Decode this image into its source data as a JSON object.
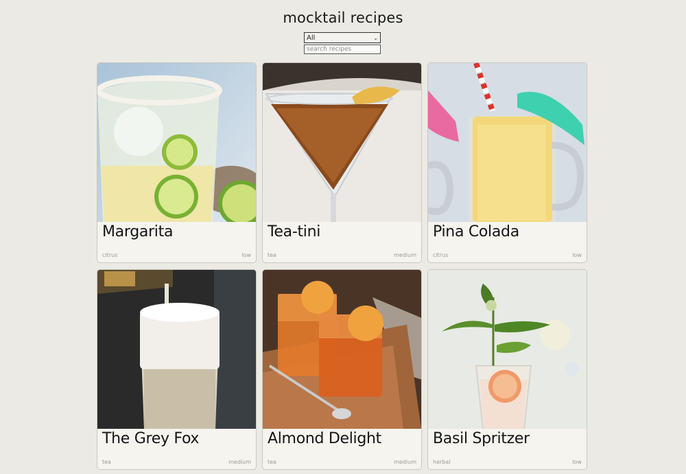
{
  "header": {
    "title": "mocktail recipes"
  },
  "filter": {
    "selected": "All"
  },
  "search": {
    "placeholder": "search recipes"
  },
  "recipes": [
    {
      "name": "Margarita",
      "category": "citrus",
      "strength": "low",
      "photo_icon": "margarita-glass-icon"
    },
    {
      "name": "Tea-tini",
      "category": "tea",
      "strength": "medium",
      "photo_icon": "martini-glass-icon"
    },
    {
      "name": "Pina Colada",
      "category": "citrus",
      "strength": "low",
      "photo_icon": "mug-with-umbrellas-icon"
    },
    {
      "name": "The Grey Fox",
      "category": "tea",
      "strength": "medium",
      "photo_icon": "foamy-glass-icon"
    },
    {
      "name": "Almond Delight",
      "category": "tea",
      "strength": "medium",
      "photo_icon": "rocks-glasses-icon"
    },
    {
      "name": "Basil Spritzer",
      "category": "herbal",
      "strength": "low",
      "photo_icon": "spritzer-glass-icon"
    }
  ]
}
